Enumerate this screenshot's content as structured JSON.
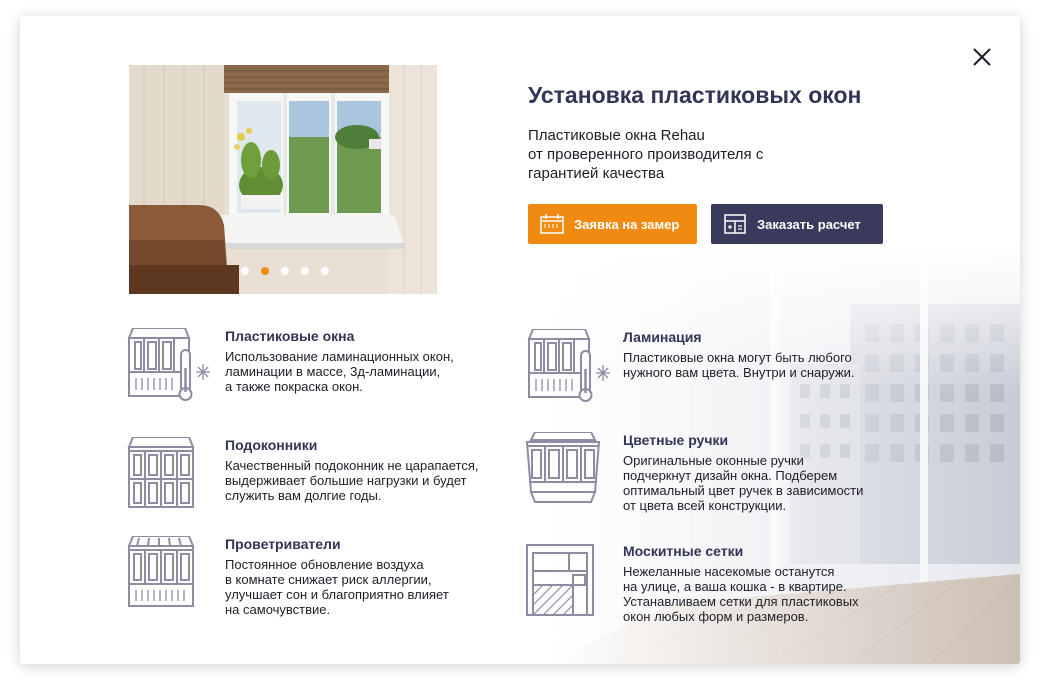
{
  "modal": {
    "title": "Установка пластиковых окон",
    "subtitle_lines": [
      "Пластиковые окна Rehau",
      "от проверенного производителя с",
      "гарантией качества"
    ],
    "close_icon": "close-icon",
    "buttons": {
      "measure": {
        "label": "Заявка на замер",
        "icon": "calendar-icon",
        "color": "#f08a10"
      },
      "calc": {
        "label": "Заказать расчет",
        "icon": "calculator-icon",
        "color": "#3a3a5e"
      }
    },
    "carousel": {
      "slide_count": 5,
      "active_index": 1
    }
  },
  "features": [
    {
      "title": "Пластиковые окна",
      "icon": "window-thermometer-icon",
      "lines": [
        "Использование ламинационных окон,",
        "ламинации в массе, 3д-ламинации,",
        "а также покраска окон."
      ]
    },
    {
      "title": "Ламинация",
      "icon": "window-thermometer-icon",
      "lines": [
        "Пластиковые окна могут быть любого",
        "нужного вам цвета. Внутри и снаружи."
      ]
    },
    {
      "title": "Подоконники",
      "icon": "window-grid-icon",
      "lines": [
        "Качественный подоконник не царапается,",
        "выдерживает большие нагрузки и будет",
        "служить вам долгие годы."
      ]
    },
    {
      "title": "Цветные ручки",
      "icon": "bay-window-icon",
      "lines": [
        "Оригинальные оконные ручки",
        "подчеркнут дизайн окна. Подберем",
        "оптимальный цвет ручек в зависимости",
        "от цвета всей конструкции."
      ]
    },
    {
      "title": "Проветриватели",
      "icon": "window-vent-icon",
      "lines": [
        "Постоянное обновление воздуха",
        "в комнате снижает риск аллергии,",
        "улучшает сон и благоприятно влияет",
        "на самочувствие."
      ]
    },
    {
      "title": "Москитные сетки",
      "icon": "mosquito-net-icon",
      "lines": [
        "Нежеланные насекомые останутся",
        "на улице, а ваша кошка - в квартире.",
        "Устанавливаем сетки для пластиковых",
        "окон любых форм и размеров."
      ]
    }
  ],
  "colors": {
    "accent": "#f08a10",
    "navy": "#333556",
    "icon_stroke": "#8e8ca3"
  }
}
